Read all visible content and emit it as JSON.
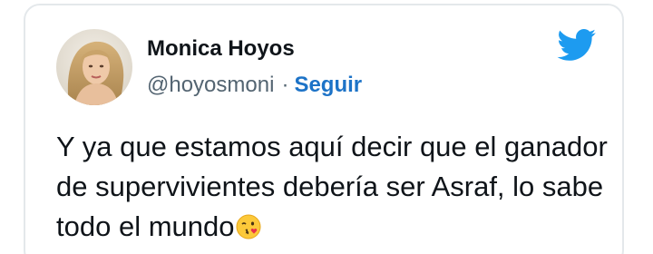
{
  "tweet": {
    "author_name": "Monica Hoyos",
    "handle": "@hoyosmoni",
    "separator": "·",
    "follow_label": "Seguir",
    "text": "Y ya que estamos aquí decir que el ganador de supervivientes debería ser Asraf, lo sabe todo el mundo",
    "emoji": "face-throwing-a-kiss-emoji"
  },
  "icons": {
    "platform_logo": "twitter-bird-icon"
  },
  "colors": {
    "twitter_blue": "#1d9bf0",
    "follow_link": "#1d73c7",
    "secondary_text": "#536471",
    "primary_text": "#0f1419",
    "card_border": "#e4e8eb"
  }
}
